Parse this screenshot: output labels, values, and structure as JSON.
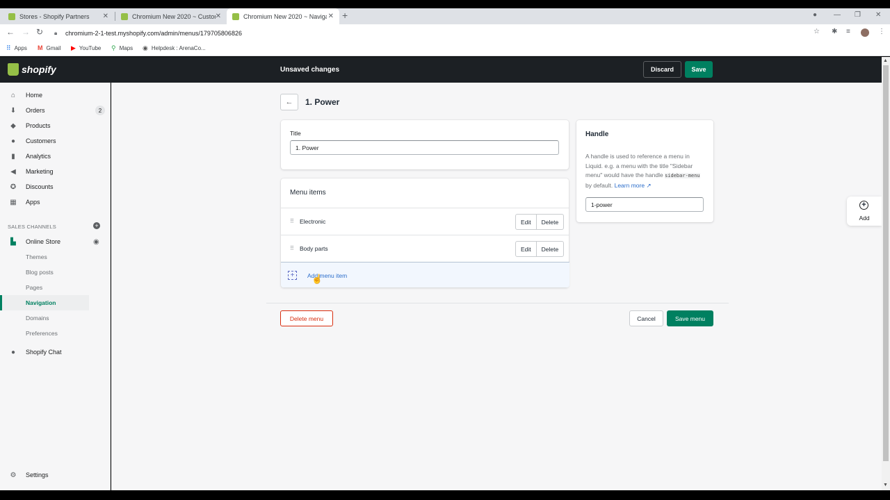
{
  "browser": {
    "tabs": [
      {
        "title": "Stores - Shopify Partners"
      },
      {
        "title": "Chromium New 2020 ~ Customi"
      },
      {
        "title": "Chromium New 2020 ~ Navigati"
      }
    ],
    "url": "chromium-2-1-test.myshopify.com/admin/menus/179705806826",
    "bookmarks": [
      "Apps",
      "Gmail",
      "YouTube",
      "Maps",
      "Helpdesk : ArenaCo..."
    ]
  },
  "topbar": {
    "brand": "shopify",
    "status": "Unsaved changes",
    "discard_label": "Discard",
    "save_label": "Save"
  },
  "sidebar": {
    "items": [
      {
        "label": "Home",
        "icon": "home-icon"
      },
      {
        "label": "Orders",
        "icon": "orders-icon",
        "badge": "2"
      },
      {
        "label": "Products",
        "icon": "tag-icon"
      },
      {
        "label": "Customers",
        "icon": "person-icon"
      },
      {
        "label": "Analytics",
        "icon": "bar-chart-icon"
      },
      {
        "label": "Marketing",
        "icon": "megaphone-icon"
      },
      {
        "label": "Discounts",
        "icon": "discount-icon"
      },
      {
        "label": "Apps",
        "icon": "apps-icon"
      }
    ],
    "channels_heading": "SALES CHANNELS",
    "online_store": "Online Store",
    "sub_items": [
      "Themes",
      "Blog posts",
      "Pages",
      "Navigation",
      "Domains",
      "Preferences"
    ],
    "shopify_chat": "Shopify Chat",
    "settings": "Settings"
  },
  "page": {
    "title": "1. Power",
    "title_field_label": "Title",
    "title_field_value": "1. Power",
    "menu_items_heading": "Menu items",
    "menu_items": [
      {
        "name": "Electronic",
        "edit": "Edit",
        "delete": "Delete"
      },
      {
        "name": "Body parts",
        "edit": "Edit",
        "delete": "Delete"
      }
    ],
    "add_menu_item": "Add menu item",
    "delete_menu": "Delete menu",
    "cancel": "Cancel",
    "save_menu": "Save menu"
  },
  "handle_card": {
    "heading": "Handle",
    "help_1": "A handle is used to reference a menu in Liquid. e.g. a menu with the title \"Sidebar menu\" would have the handle ",
    "help_code": "sidebar-menu",
    "help_2": " by default. ",
    "learn_more": "Learn more",
    "value": "1-power"
  },
  "float_add": {
    "label": "Add"
  },
  "colors": {
    "accent": "#008060",
    "topbar": "#1c2024",
    "danger": "#d72c0d",
    "link": "#2c6ecb"
  }
}
